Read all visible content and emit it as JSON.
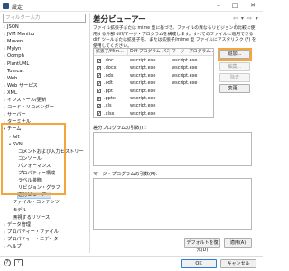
{
  "window": {
    "title": "設定",
    "minimize": "–",
    "maximize": "□",
    "close": "✕"
  },
  "filter": {
    "placeholder": "フィルター入力"
  },
  "tree": [
    {
      "label": "JSON",
      "arrow": ">",
      "indent": 1
    },
    {
      "label": "JVM Monitor",
      "arrow": ">",
      "indent": 1
    },
    {
      "label": "Maven",
      "arrow": ">",
      "indent": 1
    },
    {
      "label": "Mylyn",
      "arrow": ">",
      "indent": 1
    },
    {
      "label": "Oomph",
      "arrow": ">",
      "indent": 1
    },
    {
      "label": "PlantUML",
      "arrow": ">",
      "indent": 1
    },
    {
      "label": "Tomcat",
      "arrow": "",
      "indent": 1
    },
    {
      "label": "Web",
      "arrow": ">",
      "indent": 1
    },
    {
      "label": "Web サービス",
      "arrow": ">",
      "indent": 1
    },
    {
      "label": "XML",
      "arrow": ">",
      "indent": 1
    },
    {
      "label": "インストール/更新",
      "arrow": ">",
      "indent": 1
    },
    {
      "label": "コード・リコメンダー",
      "arrow": ">",
      "indent": 1
    },
    {
      "label": "サーバー",
      "arrow": ">",
      "indent": 1
    },
    {
      "label": "ターミナル",
      "arrow": ">",
      "indent": 1
    },
    {
      "label": "チーム",
      "arrow": "v",
      "indent": 1
    },
    {
      "label": "Git",
      "arrow": ">",
      "indent": 2
    },
    {
      "label": "SVN",
      "arrow": "v",
      "indent": 2
    },
    {
      "label": "コメントおよび入力ヒストリー",
      "arrow": "",
      "indent": 3
    },
    {
      "label": "コンソール",
      "arrow": "",
      "indent": 3
    },
    {
      "label": "パフォーマンス",
      "arrow": "",
      "indent": 3
    },
    {
      "label": "プロパティー構成",
      "arrow": "",
      "indent": 3
    },
    {
      "label": "ラベル装飾",
      "arrow": "",
      "indent": 3
    },
    {
      "label": "リビジョン・グラフ",
      "arrow": "",
      "indent": 3
    },
    {
      "label": "差分ビューアー",
      "arrow": "",
      "indent": 3,
      "selected": true
    },
    {
      "label": "ファイル・コンテンツ",
      "arrow": "",
      "indent": 2
    },
    {
      "label": "モデル",
      "arrow": "",
      "indent": 2
    },
    {
      "label": "無視するリソース",
      "arrow": "",
      "indent": 2
    },
    {
      "label": "データ管理",
      "arrow": ">",
      "indent": 1
    },
    {
      "label": "プロパティー・ファイル",
      "arrow": ">",
      "indent": 1
    },
    {
      "label": "プロパティー・エディター",
      "arrow": ">",
      "indent": 1
    },
    {
      "label": "ヘルプ",
      "arrow": ">",
      "indent": 1
    }
  ],
  "panel": {
    "title": "差分ビューアー",
    "nav": "⇦ ▾ ⇨ ▾ ⋮",
    "description": "ファイル拡張子または mime 型に基づき、ファイルの異なるリビジョンの比較に使用する外部 diff/マージ・プログラムを構成します。すべてのファイルに適用できる diff ツールまたは拡張子を、または拡張子/mime 型 ファイルにアスタリスク (*) を使用してください。"
  },
  "table": {
    "headers": [
      "拡張子/Mim...",
      "Diff プログラム パス",
      "マージ・プログラム..."
    ],
    "rows": [
      {
        "checked": true,
        "ext": ".doc",
        "diff": "wscript.exe",
        "merge": "wscript.exe"
      },
      {
        "checked": true,
        "ext": ".docx",
        "diff": "wscript.exe",
        "merge": "wscript.exe"
      },
      {
        "checked": true,
        "ext": ".ods",
        "diff": "wscript.exe",
        "merge": "wscript.exe"
      },
      {
        "checked": true,
        "ext": ".odt",
        "diff": "wscript.exe",
        "merge": "wscript.exe"
      },
      {
        "checked": true,
        "ext": ".ppt",
        "diff": "wscript.exe",
        "merge": ""
      },
      {
        "checked": true,
        "ext": ".pptx",
        "diff": "wscript.exe",
        "merge": ""
      },
      {
        "checked": true,
        "ext": ".xls",
        "diff": "wscript.exe",
        "merge": ""
      },
      {
        "checked": true,
        "ext": ".xlsx",
        "diff": "wscript.exe",
        "merge": ""
      }
    ]
  },
  "buttons": {
    "add": "追加...",
    "edit": "編集...",
    "remove": "除去",
    "change": "変更...",
    "restore_defaults": "デフォルトを復元(D)",
    "apply": "適用(A)",
    "ok": "OK",
    "cancel": "キャンセル"
  },
  "diff_args_label": "差分プログラムの引数(I):",
  "merge_args_label": "マージ・プログラムの引数(R):",
  "footer": {
    "help": "?",
    "help2": "?"
  }
}
